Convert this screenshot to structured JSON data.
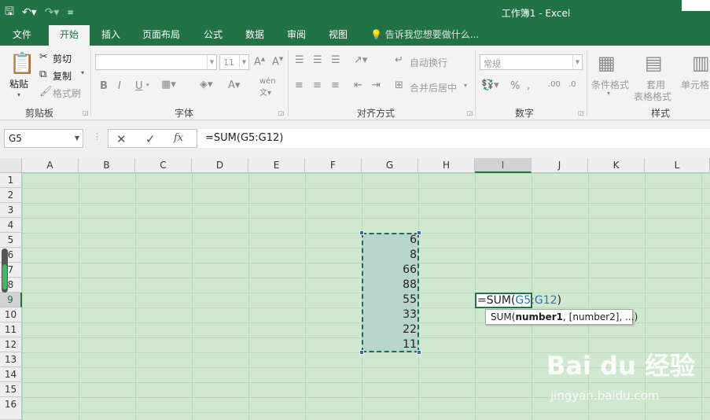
{
  "window": {
    "title": "工作簿1 - Excel"
  },
  "tabs": [
    {
      "label": "文件"
    },
    {
      "label": "开始"
    },
    {
      "label": "插入"
    },
    {
      "label": "页面布局"
    },
    {
      "label": "公式"
    },
    {
      "label": "数据"
    },
    {
      "label": "审阅"
    },
    {
      "label": "视图"
    }
  ],
  "tell_me": "告诉我您想要做什么...",
  "ribbon": {
    "clipboard": {
      "paste": "粘贴",
      "cut": "剪切",
      "copy": "复制",
      "format_painter": "格式刷",
      "label": "剪贴板"
    },
    "font": {
      "font_size": "11",
      "label": "字体"
    },
    "alignment": {
      "wrap_text": "自动换行",
      "merge_center": "合并后居中",
      "label": "对齐方式"
    },
    "number": {
      "format": "常规",
      "label": "数字"
    },
    "styles": {
      "conditional": "条件格式",
      "table_line1": "套用",
      "table_line2": "表格格式",
      "cell_styles": "单元格",
      "label": "样式"
    }
  },
  "formula_bar": {
    "name_box": "G5",
    "cancel": "✕",
    "enter": "✓",
    "fx": "fx",
    "formula": "=SUM(G5:G12)"
  },
  "sheet": {
    "columns": [
      "A",
      "B",
      "C",
      "D",
      "E",
      "F",
      "G",
      "H",
      "I",
      "J",
      "K",
      "L"
    ],
    "rows": [
      "1",
      "2",
      "3",
      "4",
      "5",
      "6",
      "7",
      "8",
      "9",
      "10",
      "11",
      "12",
      "13",
      "14",
      "15",
      "16"
    ],
    "selected_column": "I",
    "selected_row": "9",
    "g_values": [
      "6",
      "8",
      "66",
      "88",
      "55",
      "33",
      "22",
      "11"
    ],
    "editing": {
      "prefix": "=SUM(",
      "ref1": "G5",
      "colon": ":",
      "ref2": "G12",
      "suffix": ")"
    },
    "tooltip": {
      "prefix": "SUM(",
      "bold": "number1",
      "rest": ", [number2], ...)"
    }
  },
  "watermark": {
    "main": "Bai du 经验",
    "sub": "jingyan.baidu.com"
  }
}
